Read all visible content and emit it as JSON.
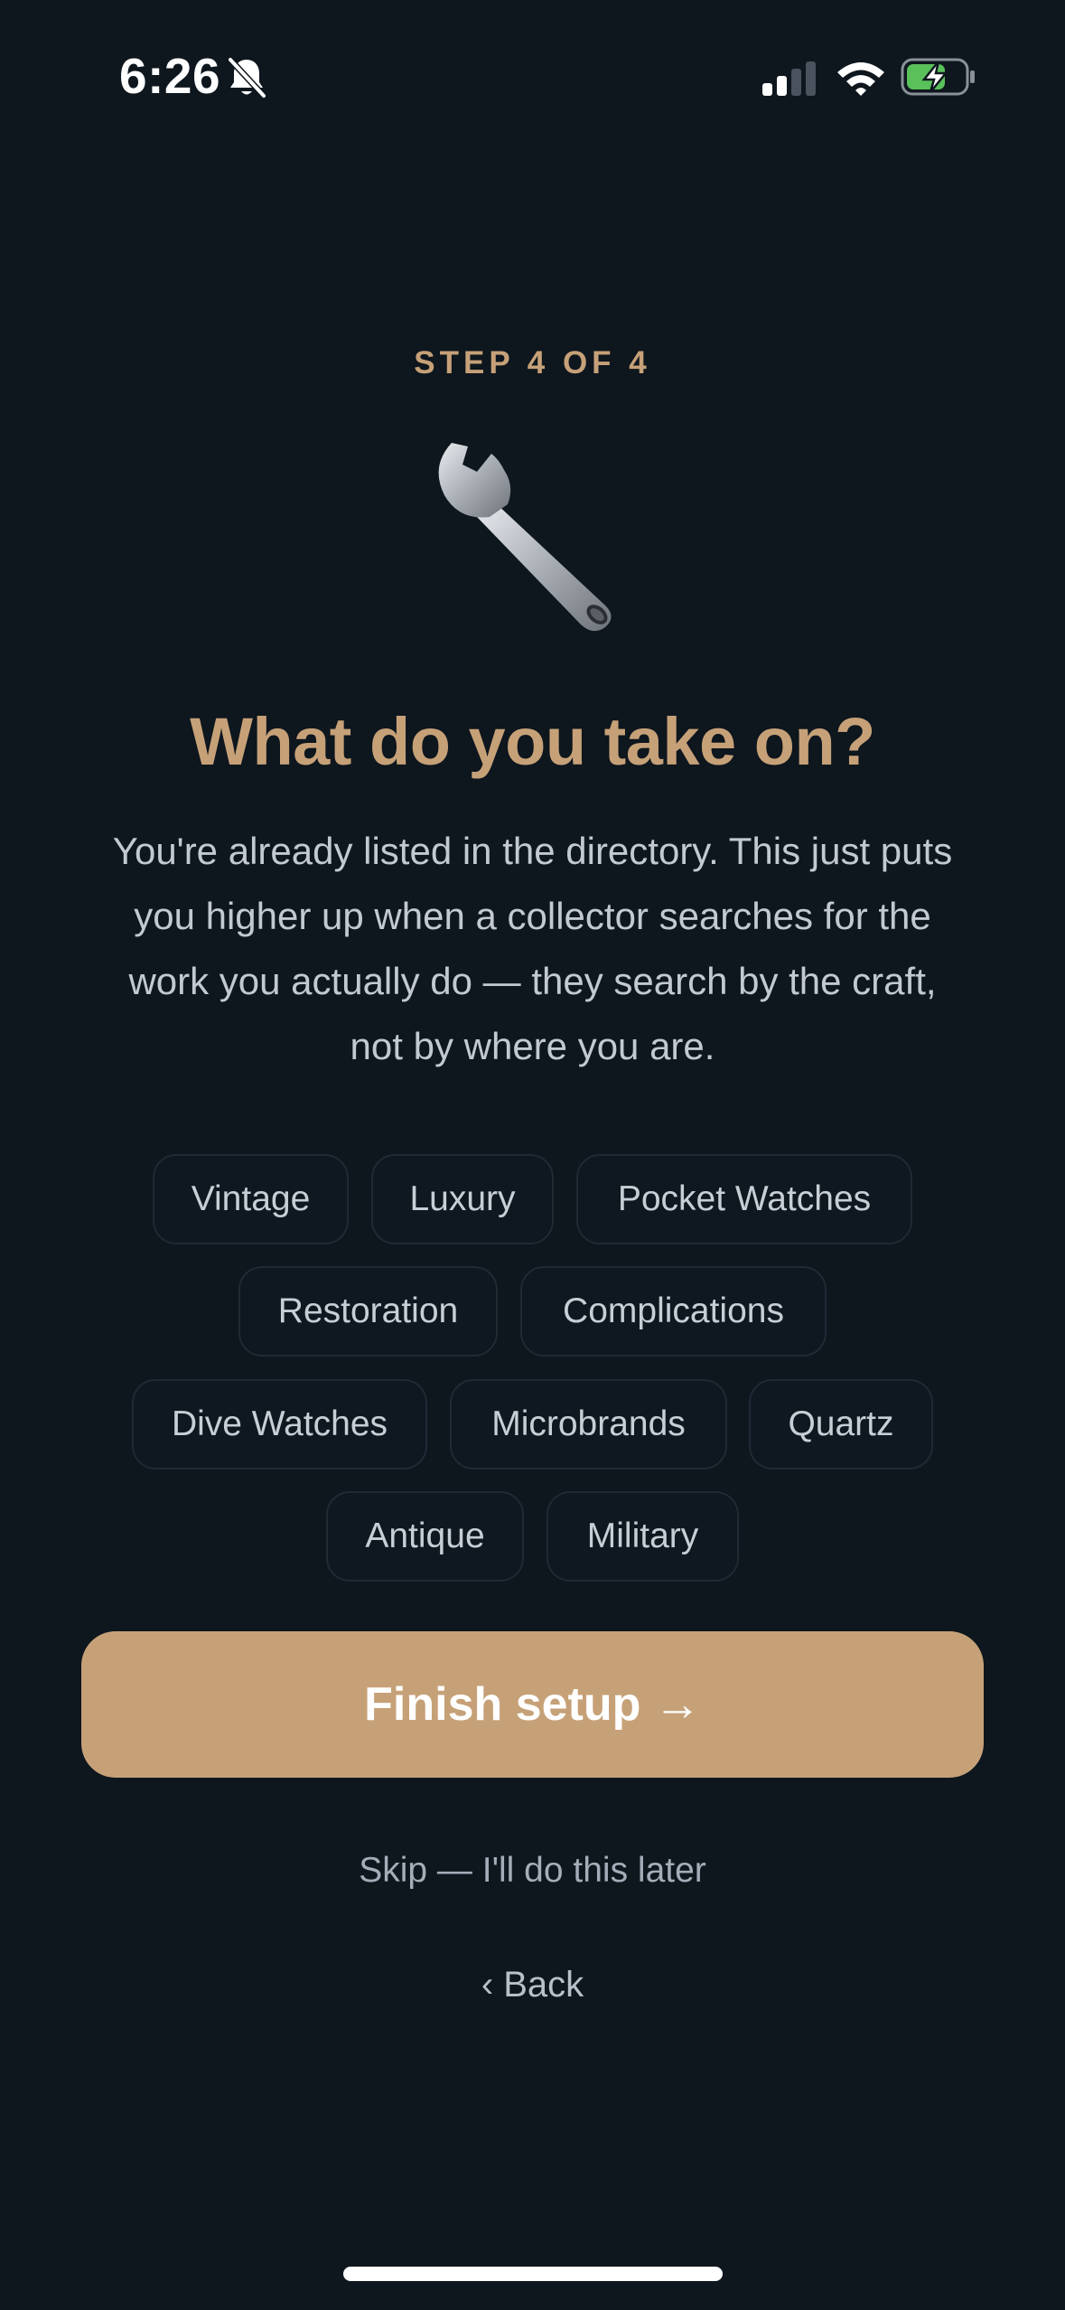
{
  "status_bar": {
    "time": "6:26"
  },
  "step_label": "STEP 4 OF 4",
  "headline": "What do you take on?",
  "description": "You're already listed in the directory. This just puts you higher up when a collector searches for the work you actually do — they search by the craft, not by where you are.",
  "tags": [
    "Vintage",
    "Luxury",
    "Pocket Watches",
    "Restoration",
    "Complications",
    "Dive Watches",
    "Microbrands",
    "Quartz",
    "Antique",
    "Military"
  ],
  "finish_button": "Finish setup →",
  "skip_link": "Skip — I'll do this later",
  "back_link": "‹ Back",
  "colors": {
    "background": "#0e161e",
    "accent": "#c6a178",
    "chip_border": "#1f2a35"
  },
  "icons": [
    "bell-slash-icon",
    "cellular-signal-icon",
    "wifi-icon",
    "battery-charging-icon",
    "wrench-icon"
  ]
}
